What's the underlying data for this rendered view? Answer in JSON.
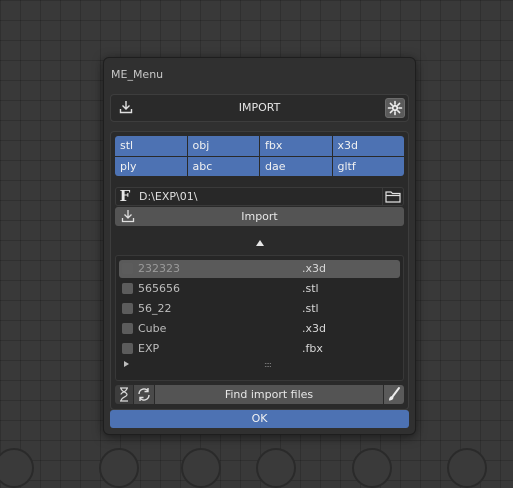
{
  "dialog": {
    "title": "ME_Menu",
    "header_label": "IMPORT",
    "formats": [
      "stl",
      "obj",
      "fbx",
      "x3d",
      "ply",
      "abc",
      "dae",
      "gltf"
    ],
    "path": "D:\\EXP\\01\\",
    "import_label": "Import",
    "files": [
      {
        "name": "232323",
        "ext": ".x3d",
        "selected": true
      },
      {
        "name": "565656",
        "ext": ".stl",
        "selected": false
      },
      {
        "name": "56_22",
        "ext": ".stl",
        "selected": false
      },
      {
        "name": "Cube",
        "ext": ".x3d",
        "selected": false
      },
      {
        "name": "EXP",
        "ext": ".fbx",
        "selected": false
      }
    ],
    "grip": "::::",
    "find_label": "Find import files",
    "ok_label": "OK"
  },
  "colors": {
    "accent": "#4d72b3",
    "background": "#393939",
    "panel": "#303030"
  },
  "icons": [
    "download-icon",
    "gear-icon",
    "font-icon",
    "folder-icon",
    "collapse-arrow-icon",
    "expand-triangle-icon",
    "hourglass-icon",
    "refresh-icon",
    "brush-icon"
  ]
}
